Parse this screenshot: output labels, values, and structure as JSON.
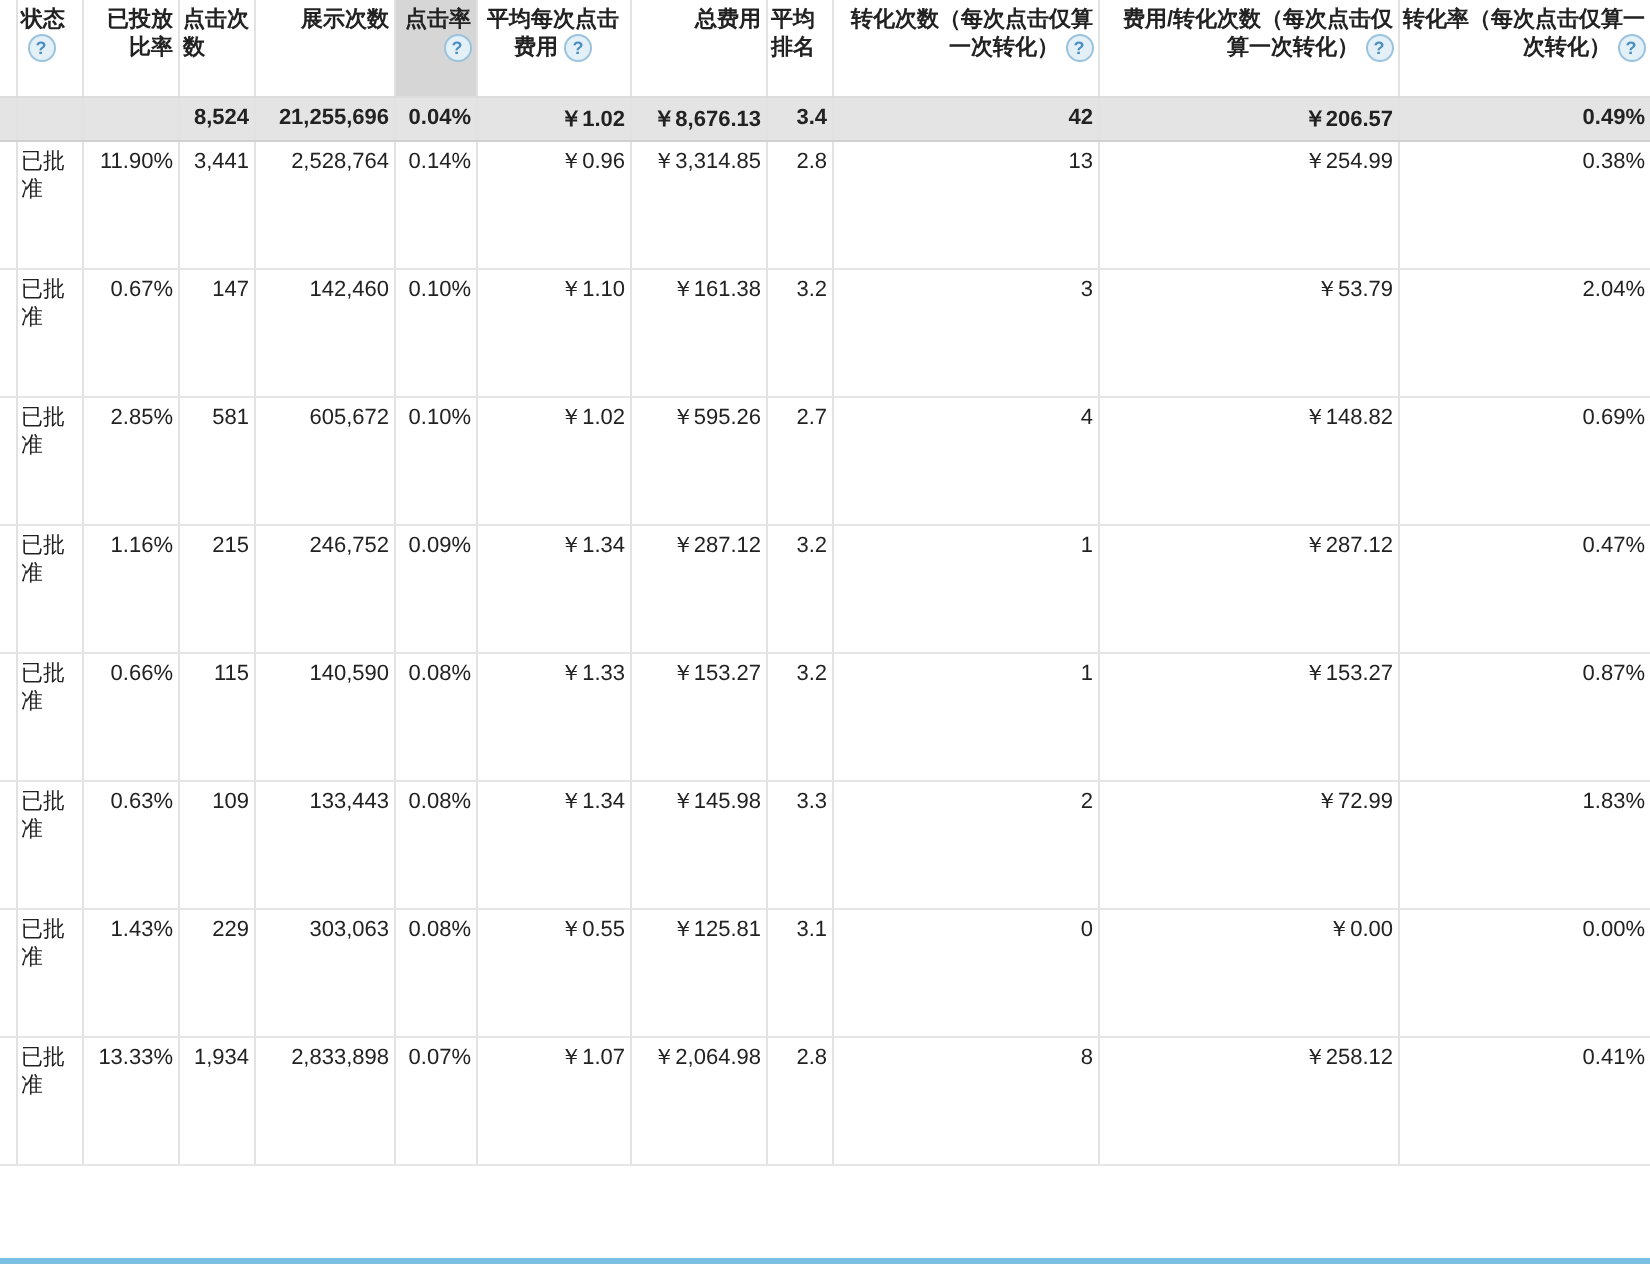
{
  "table": {
    "columns": [
      {
        "label": "状态",
        "help": "?",
        "sorted": false
      },
      {
        "label": "已投放比率",
        "sorted": false
      },
      {
        "label": "点击次数",
        "sorted": false
      },
      {
        "label": "展示次数",
        "sorted": false
      },
      {
        "label": "点击率",
        "help": "?",
        "sorted": true
      },
      {
        "label": "平均每次点击费用",
        "help": "?",
        "sorted": false
      },
      {
        "label": "总费用",
        "sorted": false
      },
      {
        "label": "平均排名",
        "sorted": false
      },
      {
        "label": "转化次数（每次点击仅算一次转化）",
        "help": "?",
        "sorted": false
      },
      {
        "label": "费用/转化次数（每次点击仅算一次转化）",
        "help": "?",
        "sorted": false
      },
      {
        "label": "转化率（每次点击仅算一次转化）",
        "help": "?",
        "sorted": false
      }
    ],
    "summary": [
      "8,524",
      "21,255,696",
      "0.04%",
      "￥1.02",
      "￥8,676.13",
      "3.4",
      "42",
      "￥206.57",
      "0.49%"
    ],
    "rows": [
      [
        "已批准",
        "11.90%",
        "3,441",
        "2,528,764",
        "0.14%",
        "￥0.96",
        "￥3,314.85",
        "2.8",
        "13",
        "￥254.99",
        "0.38%"
      ],
      [
        "已批准",
        "0.67%",
        "147",
        "142,460",
        "0.10%",
        "￥1.10",
        "￥161.38",
        "3.2",
        "3",
        "￥53.79",
        "2.04%"
      ],
      [
        "已批准",
        "2.85%",
        "581",
        "605,672",
        "0.10%",
        "￥1.02",
        "￥595.26",
        "2.7",
        "4",
        "￥148.82",
        "0.69%"
      ],
      [
        "已批准",
        "1.16%",
        "215",
        "246,752",
        "0.09%",
        "￥1.34",
        "￥287.12",
        "3.2",
        "1",
        "￥287.12",
        "0.47%"
      ],
      [
        "已批准",
        "0.66%",
        "115",
        "140,590",
        "0.08%",
        "￥1.33",
        "￥153.27",
        "3.2",
        "1",
        "￥153.27",
        "0.87%"
      ],
      [
        "已批准",
        "0.63%",
        "109",
        "133,443",
        "0.08%",
        "￥1.34",
        "￥145.98",
        "3.3",
        "2",
        "￥72.99",
        "1.83%"
      ],
      [
        "已批准",
        "1.43%",
        "229",
        "303,063",
        "0.08%",
        "￥0.55",
        "￥125.81",
        "3.1",
        "0",
        "￥0.00",
        "0.00%"
      ],
      [
        "已批准",
        "13.33%",
        "1,934",
        "2,833,898",
        "0.07%",
        "￥1.07",
        "￥2,064.98",
        "2.8",
        "8",
        "￥258.12",
        "0.41%"
      ]
    ]
  }
}
